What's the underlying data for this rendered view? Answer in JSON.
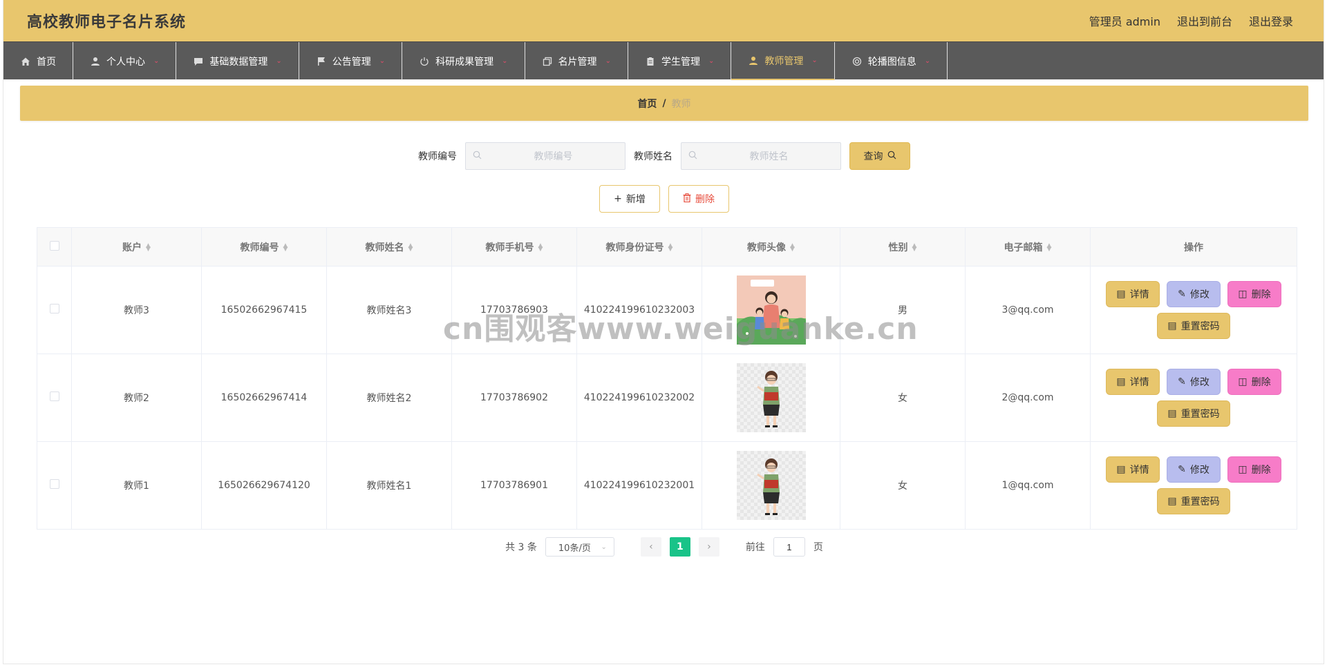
{
  "header": {
    "title": "高校教师电子名片系统",
    "admin_label": "管理员 admin",
    "front_label": "退出到前台",
    "logout_label": "退出登录"
  },
  "nav": {
    "items": [
      {
        "label": "首页",
        "icon": "home-icon",
        "chevron": false
      },
      {
        "label": "个人中心",
        "icon": "user-icon",
        "chevron": true
      },
      {
        "label": "基础数据管理",
        "icon": "chat-icon",
        "chevron": true
      },
      {
        "label": "公告管理",
        "icon": "flag-icon",
        "chevron": true
      },
      {
        "label": "科研成果管理",
        "icon": "power-icon",
        "chevron": true
      },
      {
        "label": "名片管理",
        "icon": "copy-icon",
        "chevron": true
      },
      {
        "label": "学生管理",
        "icon": "clipboard-icon",
        "chevron": true
      },
      {
        "label": "教师管理",
        "icon": "user-icon",
        "chevron": true,
        "active": true
      },
      {
        "label": "轮播图信息",
        "icon": "globe-icon",
        "chevron": true
      }
    ]
  },
  "breadcrumb": {
    "home": "首页",
    "sep": "/",
    "current": "教师"
  },
  "search": {
    "teacher_no_label": "教师编号",
    "teacher_no_placeholder": "教师编号",
    "teacher_name_label": "教师姓名",
    "teacher_name_placeholder": "教师姓名",
    "query_label": "查询"
  },
  "actions": {
    "add_label": "新增",
    "delete_label": "删除"
  },
  "table": {
    "headers": [
      "账户",
      "教师编号",
      "教师姓名",
      "教师手机号",
      "教师身份证号",
      "教师头像",
      "性别",
      "电子邮箱",
      "操作"
    ],
    "rows": [
      {
        "account": "教师3",
        "no": "16502662967415",
        "name": "教师姓名3",
        "phone": "17703786903",
        "id_card": "410224199610232003",
        "avatar": "family-illustration",
        "gender": "男",
        "email": "3@qq.com"
      },
      {
        "account": "教师2",
        "no": "16502662967414",
        "name": "教师姓名2",
        "phone": "17703786902",
        "id_card": "410224199610232002",
        "avatar": "teacher-illustration",
        "gender": "女",
        "email": "2@qq.com"
      },
      {
        "account": "教师1",
        "no": "165026629674120",
        "name": "教师姓名1",
        "phone": "17703786901",
        "id_card": "410224199610232001",
        "avatar": "teacher-illustration",
        "gender": "女",
        "email": "1@qq.com"
      }
    ],
    "op_labels": {
      "detail": "详情",
      "edit": "修改",
      "delete": "删除",
      "reset": "重置密码"
    }
  },
  "pagination": {
    "total_label": "共 3 条",
    "page_size_label": "10条/页",
    "current_page": "1",
    "goto_label": "前往",
    "goto_value": "1",
    "page_unit": "页"
  },
  "watermark": "cn围观客www.weiguanke.cn",
  "colors": {
    "primary": "#e8c66d",
    "nav_bg": "#5a5a5a",
    "active_page": "#19c388",
    "edit": "#b8bdee",
    "remove": "#f77cc8"
  }
}
